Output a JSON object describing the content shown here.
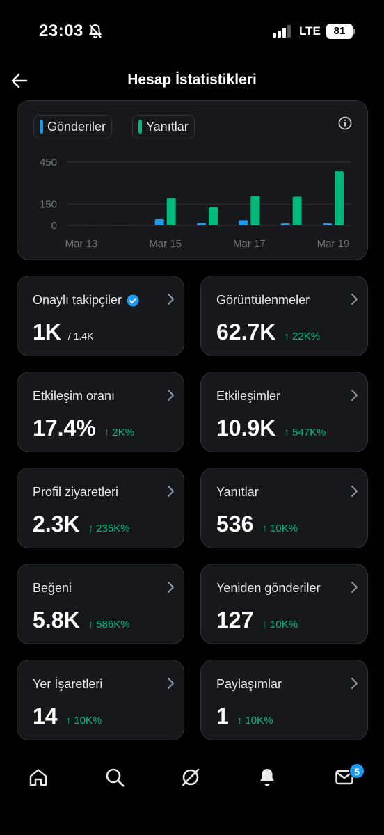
{
  "status_bar": {
    "time": "23:03",
    "network": "LTE",
    "battery": "81"
  },
  "header": {
    "title": "Hesap İstatistikleri"
  },
  "colors": {
    "posts": "#1d9bf0",
    "replies": "#00ba7c",
    "verified": "#1d9bf0",
    "delta": "#00ba7c"
  },
  "chart": {
    "legend": [
      {
        "label": "Gönderiler",
        "color": "#1d9bf0"
      },
      {
        "label": "Yanıtlar",
        "color": "#00ba7c"
      }
    ]
  },
  "chart_data": {
    "type": "bar",
    "categories": [
      "Mar 13",
      "Mar 14",
      "Mar 15",
      "Mar 16",
      "Mar 17",
      "Mar 18",
      "Mar 19"
    ],
    "x_tick_labels": [
      "Mar 13",
      "Mar 15",
      "Mar 17",
      "Mar 19"
    ],
    "y_ticks": [
      "0",
      "150",
      "450"
    ],
    "ylim": [
      0,
      450
    ],
    "series": [
      {
        "name": "Gönderiler",
        "color": "#1d9bf0",
        "values": [
          0,
          0,
          45,
          18,
          38,
          12,
          10
        ]
      },
      {
        "name": "Yanıtlar",
        "color": "#00ba7c",
        "values": [
          0,
          0,
          195,
          130,
          210,
          205,
          385
        ]
      }
    ],
    "grid": true,
    "legend_position": "top-left"
  },
  "stats": [
    {
      "label": "Onaylı takipçiler",
      "value": "1K",
      "sub": "/ 1.4K",
      "delta": "",
      "verified": true
    },
    {
      "label": "Görüntülenmeler",
      "value": "62.7K",
      "sub": "",
      "delta": "↑ 22K%"
    },
    {
      "label": "Etkileşim oranı",
      "value": "17.4%",
      "sub": "",
      "delta": "↑ 2K%"
    },
    {
      "label": "Etkileşimler",
      "value": "10.9K",
      "sub": "",
      "delta": "↑ 547K%"
    },
    {
      "label": "Profil ziyaretleri",
      "value": "2.3K",
      "sub": "",
      "delta": "↑ 235K%"
    },
    {
      "label": "Yanıtlar",
      "value": "536",
      "sub": "",
      "delta": "↑ 10K%"
    },
    {
      "label": "Beğeni",
      "value": "5.8K",
      "sub": "",
      "delta": "↑ 586K%"
    },
    {
      "label": "Yeniden gönderiler",
      "value": "127",
      "sub": "",
      "delta": "↑ 10K%"
    },
    {
      "label": "Yer İşaretleri",
      "value": "14",
      "sub": "",
      "delta": "↑ 10K%"
    },
    {
      "label": "Paylaşımlar",
      "value": "1",
      "sub": "",
      "delta": "↑ 10K%"
    }
  ],
  "nav": {
    "items": [
      "home-icon",
      "search-icon",
      "grok-icon",
      "notifications-icon",
      "messages-icon"
    ],
    "messages_badge": "5"
  }
}
